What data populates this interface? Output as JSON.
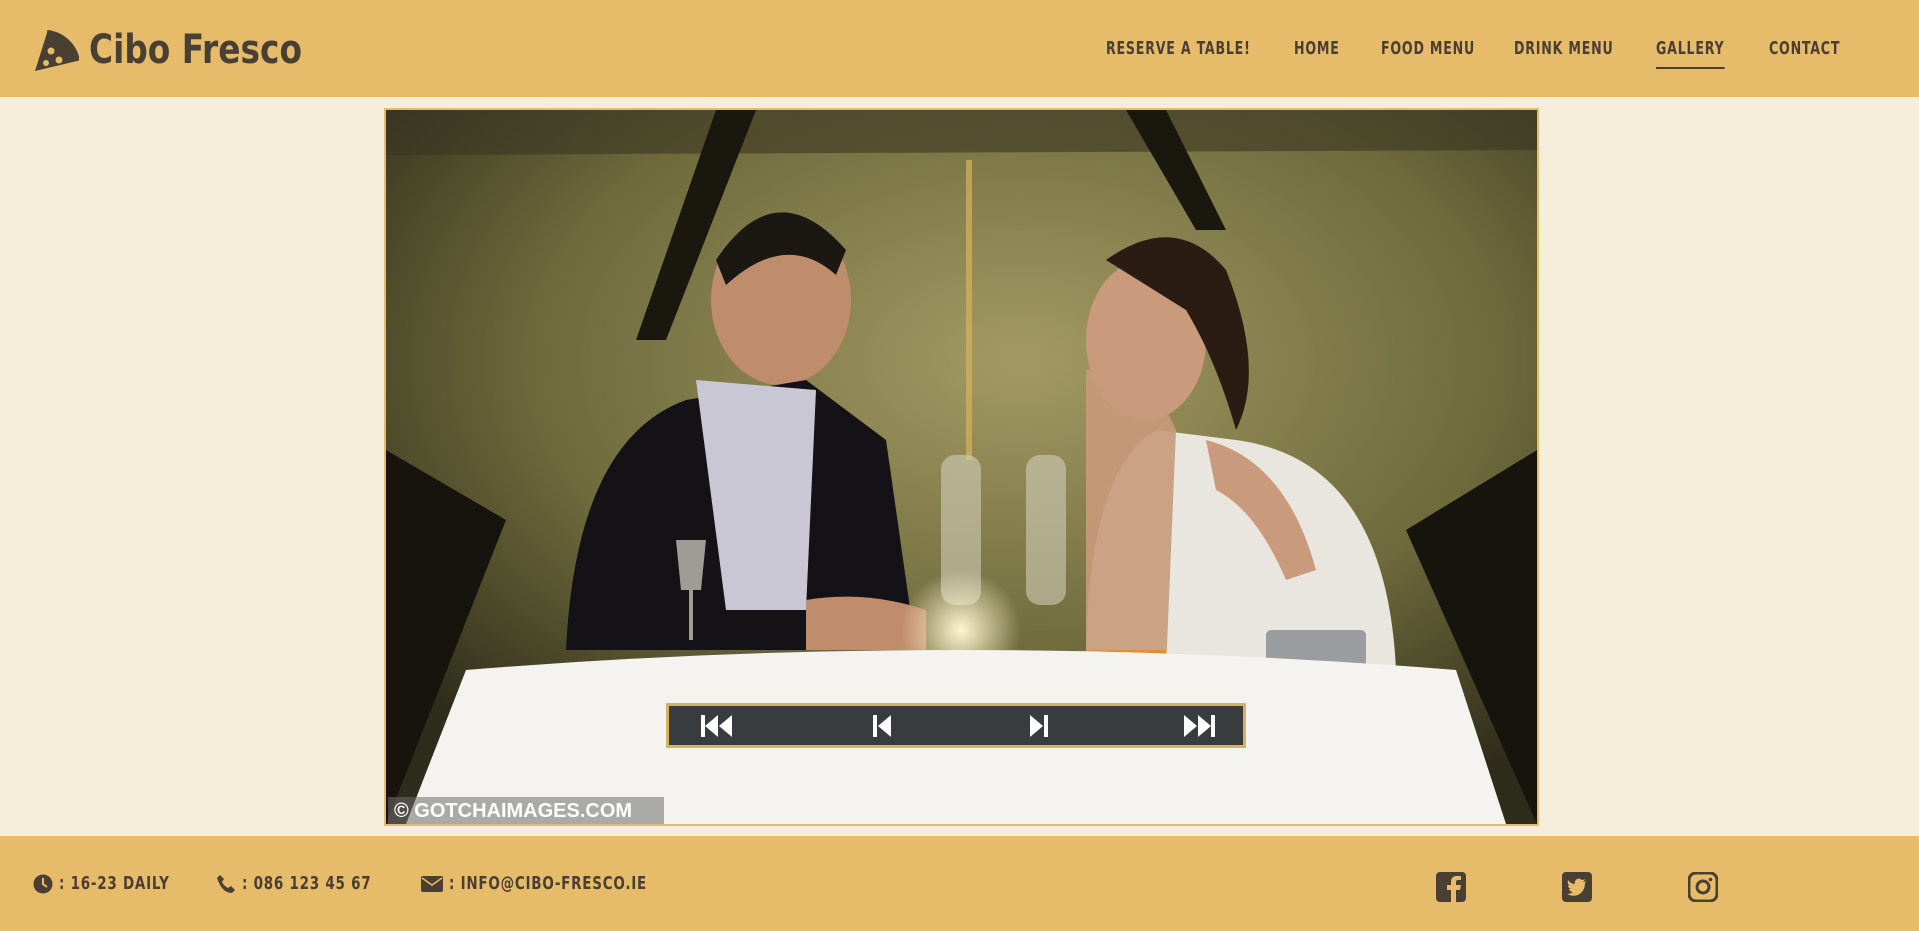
{
  "brand": {
    "name": "Cibo Fresco",
    "logo_icon": "pizza-slice-icon"
  },
  "nav": {
    "items": [
      {
        "label": "RESERVE A TABLE!"
      },
      {
        "label": "HOME"
      },
      {
        "label": "FOOD MENU"
      },
      {
        "label": "DRINK MENU"
      },
      {
        "label": "GALLERY",
        "active": true
      },
      {
        "label": "CONTACT"
      }
    ]
  },
  "gallery": {
    "watermark": "© GOTCHAIMAGES.COM",
    "controls": {
      "first": "first-slide-icon",
      "previous": "previous-slide-icon",
      "next": "next-slide-icon",
      "last": "last-slide-icon"
    }
  },
  "footer": {
    "hours": ": 16-23 DAILY",
    "phone": ": 086 123 45 67",
    "email": ": INFO@CIBO-FRESCO.IE",
    "social": [
      "facebook-icon",
      "twitter-icon",
      "instagram-icon"
    ]
  },
  "colors": {
    "header_bg": "#e6bc6a",
    "page_bg": "#f5eedb",
    "text_dark": "#4a3f33",
    "control_bg": "#383c3f"
  }
}
